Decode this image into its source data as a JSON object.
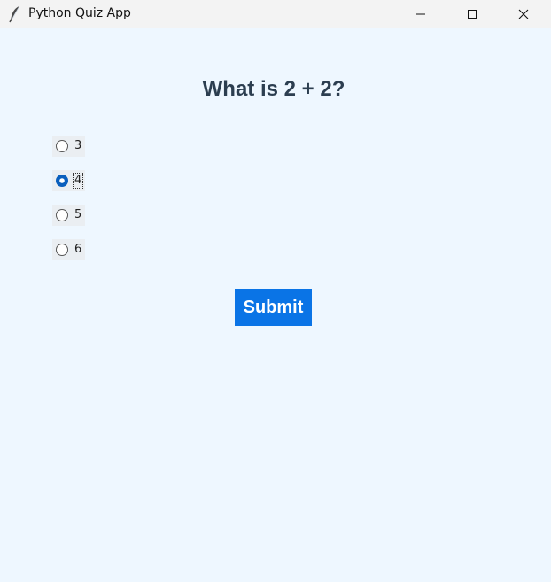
{
  "window": {
    "title": "Python Quiz App",
    "app_icon": "feather-icon",
    "controls": [
      "minimize-icon",
      "maximize-icon",
      "close-icon"
    ]
  },
  "quiz": {
    "question": "What is 2 + 2?",
    "options": [
      {
        "label": "3",
        "selected": false
      },
      {
        "label": "4",
        "selected": true
      },
      {
        "label": "5",
        "selected": false
      },
      {
        "label": "6",
        "selected": false
      }
    ],
    "submit_label": "Submit"
  },
  "colors": {
    "background": "#eef7ff",
    "question_text": "#2c3e50",
    "submit_bg": "#0a74e6",
    "submit_text": "#ffffff",
    "radio_selected": "#0a5fbd"
  }
}
